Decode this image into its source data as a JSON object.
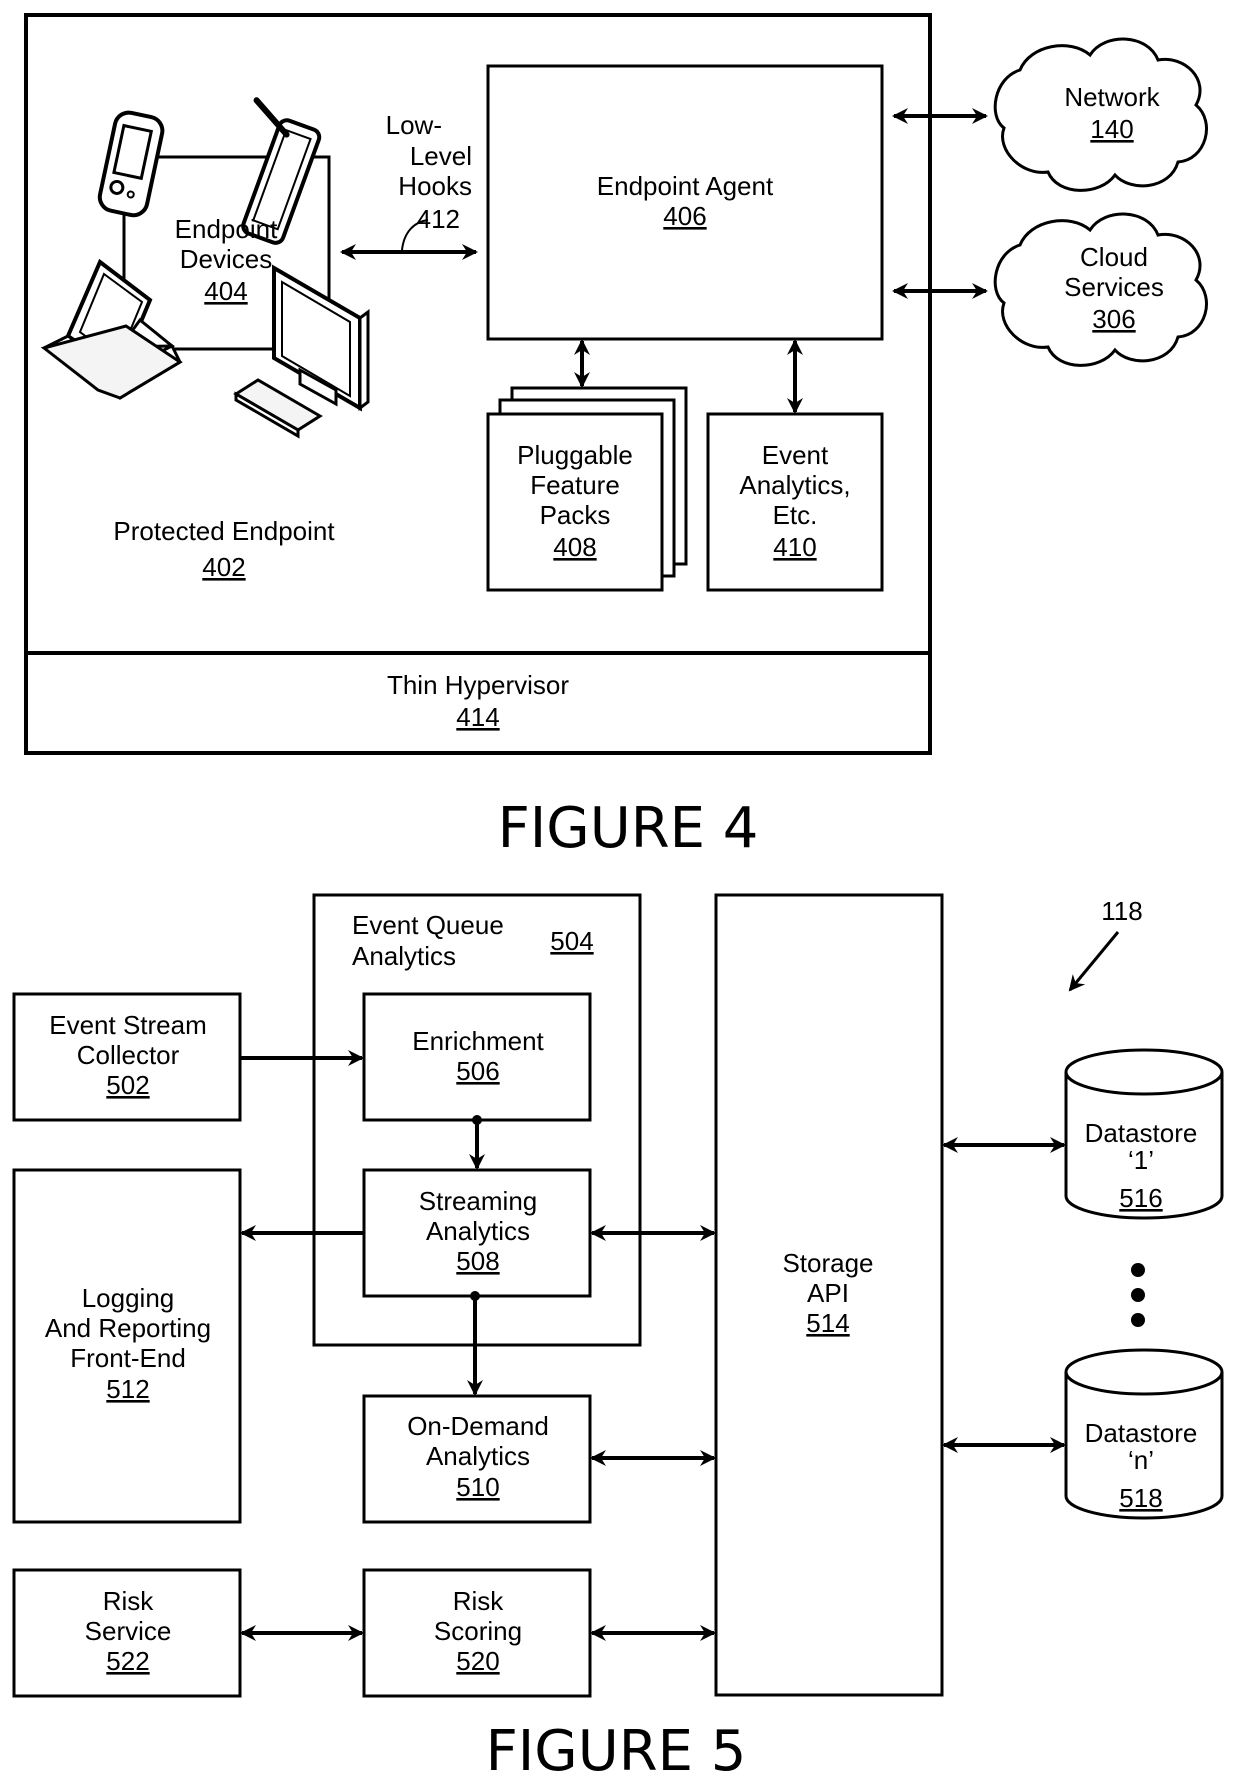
{
  "figure4": {
    "caption": "FIGURE 4",
    "protected_endpoint": {
      "label": "Protected Endpoint",
      "ref": "402"
    },
    "endpoint_devices": {
      "line1": "Endpoint",
      "line2": "Devices",
      "ref": "404"
    },
    "low_level_hooks": {
      "line1": "Low-",
      "line2": "Level",
      "line3": "Hooks",
      "ref": "412"
    },
    "endpoint_agent": {
      "label": "Endpoint Agent",
      "ref": "406"
    },
    "feature_packs": {
      "line1": "Pluggable",
      "line2": "Feature",
      "line3": "Packs",
      "ref": "408"
    },
    "event_analytics": {
      "line1": "Event",
      "line2": "Analytics,",
      "line3": "Etc.",
      "ref": "410"
    },
    "thin_hypervisor": {
      "label": "Thin Hypervisor",
      "ref": "414"
    },
    "network": {
      "label": "Network",
      "ref": "140"
    },
    "cloud_services": {
      "line1": "Cloud",
      "line2": "Services",
      "ref": "306"
    }
  },
  "figure5": {
    "caption": "FIGURE 5",
    "system_ref": "118",
    "event_queue": {
      "line1": "Event Queue",
      "line2": "Analytics",
      "ref": "504"
    },
    "collector": {
      "line1": "Event Stream",
      "line2": "Collector",
      "ref": "502"
    },
    "enrichment": {
      "label": "Enrichment",
      "ref": "506"
    },
    "streaming": {
      "line1": "Streaming",
      "line2": "Analytics",
      "ref": "508"
    },
    "logging": {
      "line1": "Logging",
      "line2": "And Reporting",
      "line3": "Front-End",
      "ref": "512"
    },
    "on_demand": {
      "line1": "On-Demand",
      "line2": "Analytics",
      "ref": "510"
    },
    "storage_api": {
      "line1": "Storage",
      "line2": "API",
      "ref": "514"
    },
    "datastore1": {
      "line1": "Datastore",
      "line2": "‘1’",
      "ref": "516"
    },
    "datastoren": {
      "line1": "Datastore",
      "line2": "‘n’",
      "ref": "518"
    },
    "risk_service": {
      "line1": "Risk",
      "line2": "Service",
      "ref": "522"
    },
    "risk_scoring": {
      "line1": "Risk",
      "line2": "Scoring",
      "ref": "520"
    }
  }
}
